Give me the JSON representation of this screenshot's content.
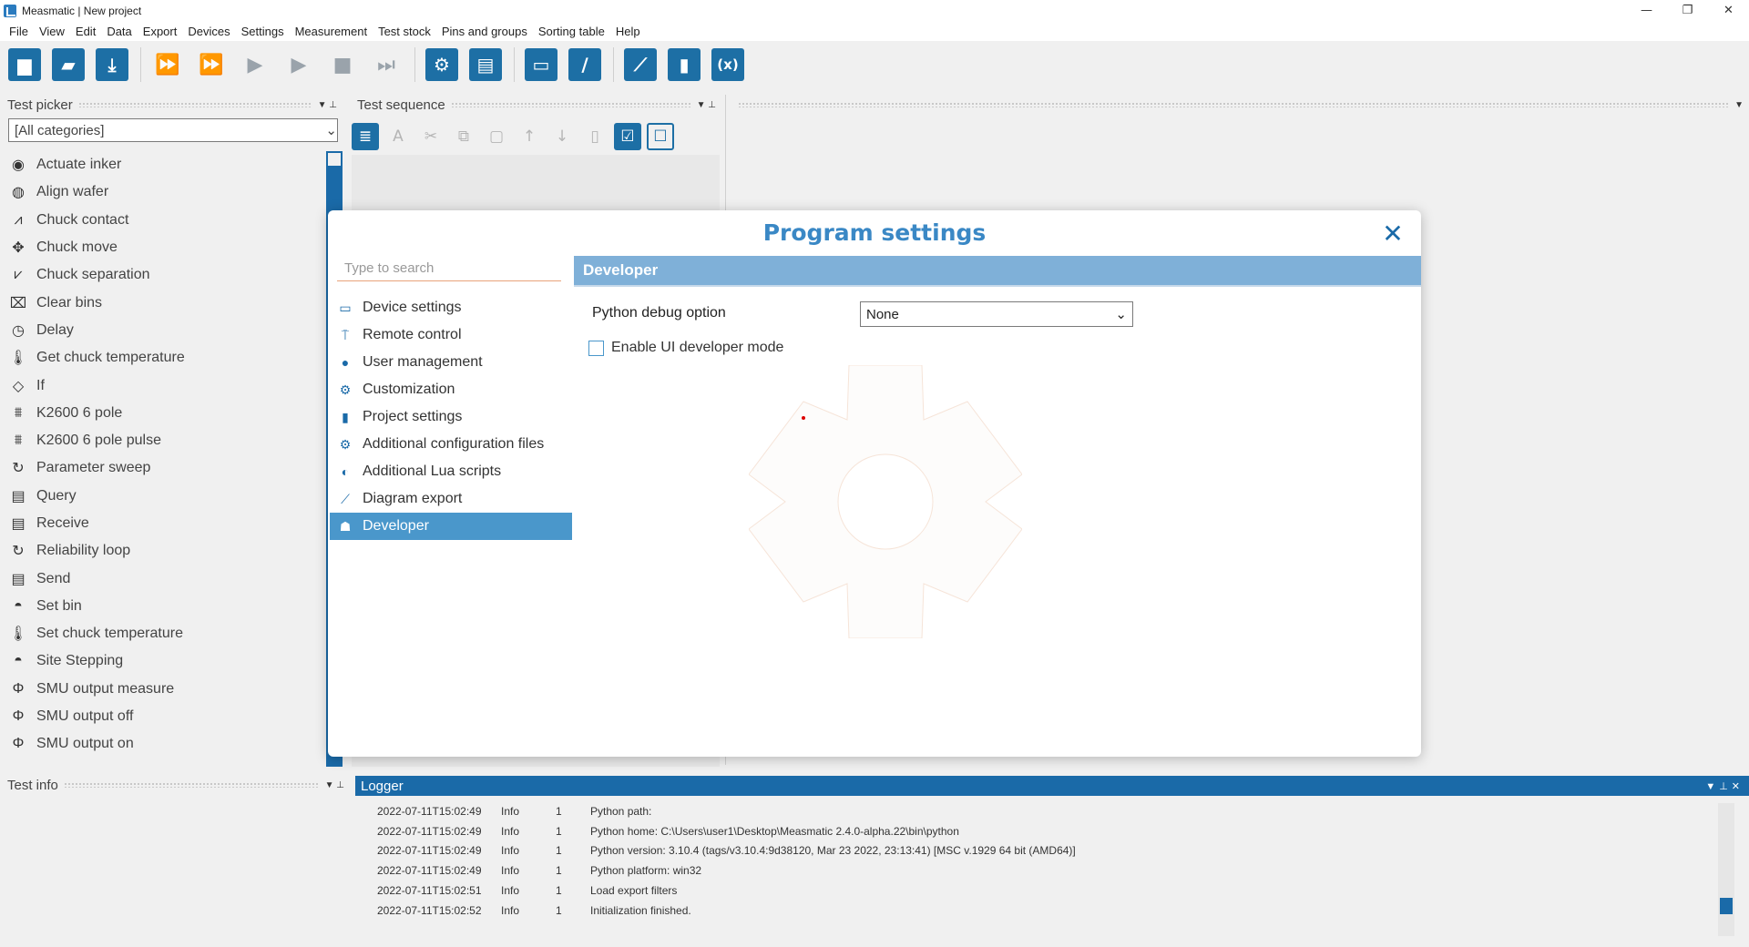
{
  "window": {
    "title": "Measmatic | New project",
    "minimize": "—",
    "restore": "❐",
    "close": "✕"
  },
  "menu": [
    "File",
    "View",
    "Edit",
    "Data",
    "Export",
    "Devices",
    "Settings",
    "Measurement",
    "Test stock",
    "Pins and groups",
    "Sorting table",
    "Help"
  ],
  "toolbar": {
    "icons": [
      "new-file-icon",
      "open-folder-icon",
      "save-download-icon",
      "run-all-icon",
      "run-all-plus-icon",
      "play-icon",
      "play-plus-icon",
      "stop-icon",
      "skip-end-icon",
      "settings-gear-icon",
      "clipboard-icon",
      "device-icon",
      "calibrate-icon",
      "line-chart-icon",
      "bar-chart-icon",
      "variable-icon"
    ]
  },
  "test_picker": {
    "title": "Test picker",
    "category": "[All categories]",
    "items": [
      {
        "label": "Actuate inker",
        "icon": "◉"
      },
      {
        "label": "Align wafer",
        "icon": "◍"
      },
      {
        "label": "Chuck contact",
        "icon": "⩘"
      },
      {
        "label": "Chuck move",
        "icon": "✥"
      },
      {
        "label": "Chuck separation",
        "icon": "⩗"
      },
      {
        "label": "Clear bins",
        "icon": "⌧"
      },
      {
        "label": "Delay",
        "icon": "◷"
      },
      {
        "label": "Get chuck temperature",
        "icon": "🌡"
      },
      {
        "label": "If",
        "icon": "◇"
      },
      {
        "label": "K2600 6 pole",
        "icon": "⩩"
      },
      {
        "label": "K2600 6 pole pulse",
        "icon": "⩩"
      },
      {
        "label": "Parameter sweep",
        "icon": "↻"
      },
      {
        "label": "Query",
        "icon": "▤"
      },
      {
        "label": "Receive",
        "icon": "▤"
      },
      {
        "label": "Reliability loop",
        "icon": "↻"
      },
      {
        "label": "Send",
        "icon": "▤"
      },
      {
        "label": "Set bin",
        "icon": "◓"
      },
      {
        "label": "Set chuck temperature",
        "icon": "🌡"
      },
      {
        "label": "Site Stepping",
        "icon": "◓"
      },
      {
        "label": "SMU output measure",
        "icon": "Φ"
      },
      {
        "label": "SMU output off",
        "icon": "Φ"
      },
      {
        "label": "SMU output on",
        "icon": "Φ"
      }
    ]
  },
  "test_sequence": {
    "title": "Test sequence"
  },
  "test_info": {
    "title": "Test info"
  },
  "logger": {
    "title": "Logger",
    "rows": [
      {
        "ts": "2022-07-11T15:02:49",
        "level": "Info",
        "n": "1",
        "msg": "Python path:"
      },
      {
        "ts": "2022-07-11T15:02:49",
        "level": "Info",
        "n": "1",
        "msg": "Python home: C:\\Users\\user1\\Desktop\\Measmatic 2.4.0-alpha.22\\bin\\python"
      },
      {
        "ts": "2022-07-11T15:02:49",
        "level": "Info",
        "n": "1",
        "msg": "Python version: 3.10.4 (tags/v3.10.4:9d38120, Mar 23 2022, 23:13:41) [MSC v.1929 64 bit (AMD64)]"
      },
      {
        "ts": "2022-07-11T15:02:49",
        "level": "Info",
        "n": "1",
        "msg": "Python platform: win32"
      },
      {
        "ts": "2022-07-11T15:02:51",
        "level": "Info",
        "n": "1",
        "msg": "Load export filters"
      },
      {
        "ts": "2022-07-11T15:02:52",
        "level": "Info",
        "n": "1",
        "msg": "Initialization finished."
      }
    ]
  },
  "dialog": {
    "title": "Program settings",
    "search_placeholder": "Type to search",
    "nav": [
      {
        "label": "Device settings",
        "icon": "▭"
      },
      {
        "label": "Remote control",
        "icon": "⍑"
      },
      {
        "label": "User management",
        "icon": "●"
      },
      {
        "label": "Customization",
        "icon": "⚙"
      },
      {
        "label": "Project settings",
        "icon": "▮"
      },
      {
        "label": "Additional configuration files",
        "icon": "⚙"
      },
      {
        "label": "Additional Lua scripts",
        "icon": "◐"
      },
      {
        "label": "Diagram export",
        "icon": "⟋"
      },
      {
        "label": "Developer",
        "icon": "☗"
      }
    ],
    "selected": "Developer",
    "section": "Developer",
    "python_debug_label": "Python debug option",
    "python_debug_value": "None",
    "ui_dev_label": "Enable UI developer mode"
  }
}
